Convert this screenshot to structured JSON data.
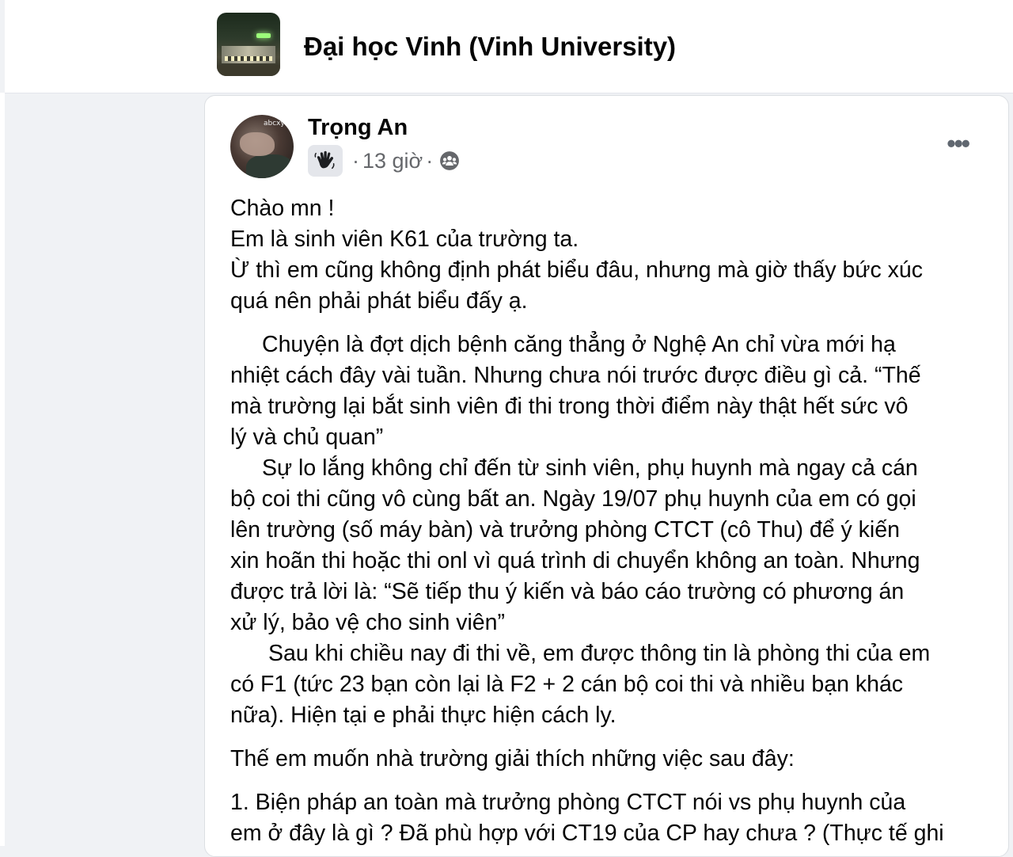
{
  "group": {
    "name": "Đại học Vinh (Vinh University)",
    "avatar_icon": "campus-photo"
  },
  "post": {
    "author": "Trọng An",
    "badge_icon": "waving-hand-icon",
    "time": "13 giờ",
    "separator": "·",
    "audience_icon": "group-members-icon",
    "more_label": "•••",
    "p1": [
      "Chào mn !",
      "Em là sinh viên K61 của trường ta.",
      "Ừ thì em cũng không định phát biểu đâu, nhưng mà giờ thấy bức xúc",
      "quá nên phải phát biểu đấy ạ."
    ],
    "p2": [
      "Chuyện là đợt dịch bệnh căng thẳng ở Nghệ An chỉ vừa mới hạ",
      "nhiệt cách đây vài tuần. Nhưng chưa nói trước được điều gì cả. “Thế",
      "mà trường lại bắt sinh viên đi thi trong thời điểm này thật hết sức vô",
      "lý và chủ quan”"
    ],
    "p3": [
      "Sự lo lắng không chỉ đến từ sinh viên, phụ huynh mà ngay cả cán",
      "bộ coi thi cũng vô cùng bất an. Ngày 19/07 phụ huynh của em có gọi",
      "lên trường (số máy bàn) và trưởng phòng CTCT (cô Thu) để ý kiến",
      "xin hoãn thi hoặc thi onl vì quá trình di chuyển không an toàn. Nhưng",
      "được trả lời là: “Sẽ tiếp thu ý kiến và báo cáo trường có phương án",
      "xử lý, bảo vệ cho sinh viên”"
    ],
    "p4": [
      "Sau khi chiều nay đi thi về, em được thông tin là phòng thi của em",
      "có F1 (tức 23 bạn còn lại là F2 + 2 cán bộ coi thi và nhiều bạn khác",
      "nữa). Hiện tại e phải thực hiện cách ly."
    ],
    "p5": "Thế em muốn nhà trường giải thích những việc sau đây:",
    "p6": [
      "1. Biện pháp an toàn mà trưởng phòng CTCT nói vs phụ huynh của",
      "em ở đây là gì ? Đã phù hợp với CT19 của CP hay chưa ? (Thực tế ghi"
    ]
  }
}
